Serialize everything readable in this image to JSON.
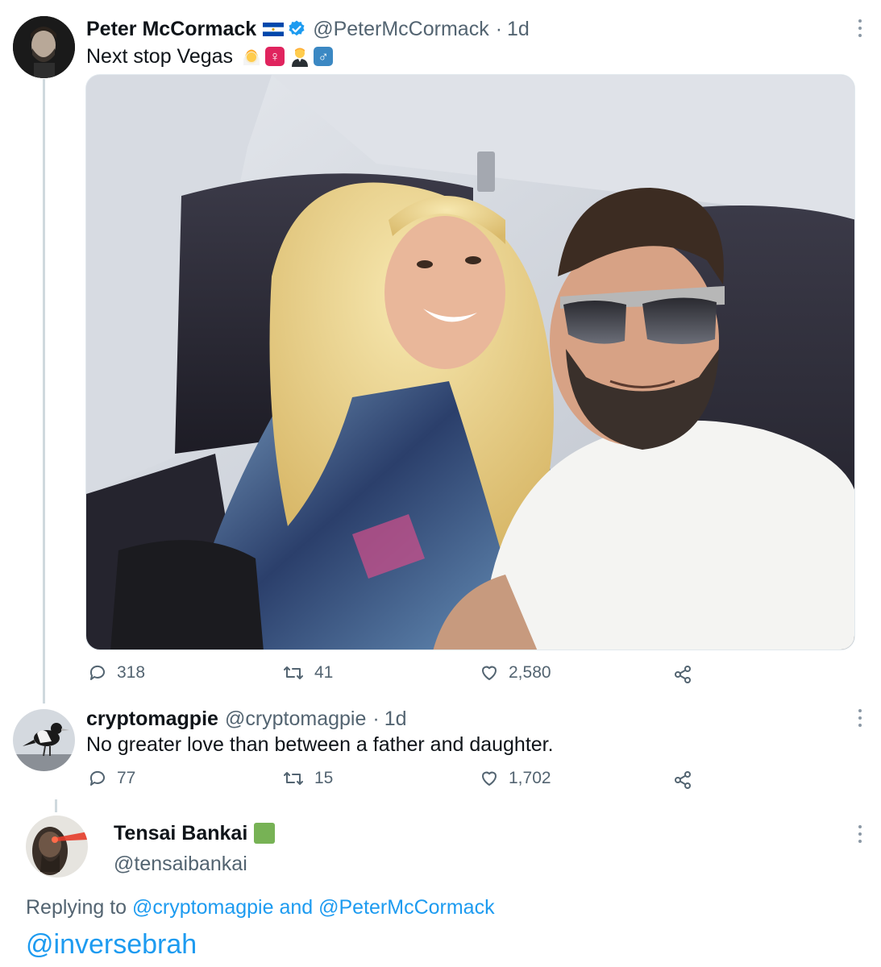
{
  "tweet": {
    "author_name": "Peter McCormack",
    "author_handle": "@PeterMcCormack",
    "separator": "·",
    "time": "1d",
    "text": "Next stop Vegas",
    "emojis": [
      "woman-bride-icon",
      "female-sign-icon",
      "man-in-tuxedo-icon",
      "male-sign-icon"
    ],
    "actions": {
      "replies": "318",
      "retweets": "41",
      "likes": "2,580"
    }
  },
  "reply1": {
    "author_name": "cryptomagpie",
    "author_handle": "@cryptomagpie",
    "separator": "·",
    "time": "1d",
    "text": "No greater love than between a father and daughter.",
    "actions": {
      "replies": "77",
      "retweets": "15",
      "likes": "1,702"
    }
  },
  "reply2": {
    "author_name": "Tensai Bankai",
    "author_handle": "@tensaibankai",
    "replying_prefix": "Replying to",
    "replying_user1": "@cryptomagpie",
    "replying_and": "and",
    "replying_user2": "@PeterMcCormack",
    "text": "@inversebrah"
  },
  "colors": {
    "accent": "#1d9bf0",
    "secondary_text": "#536471",
    "verified": "#1d9bf0",
    "green_square": "#77b255"
  }
}
